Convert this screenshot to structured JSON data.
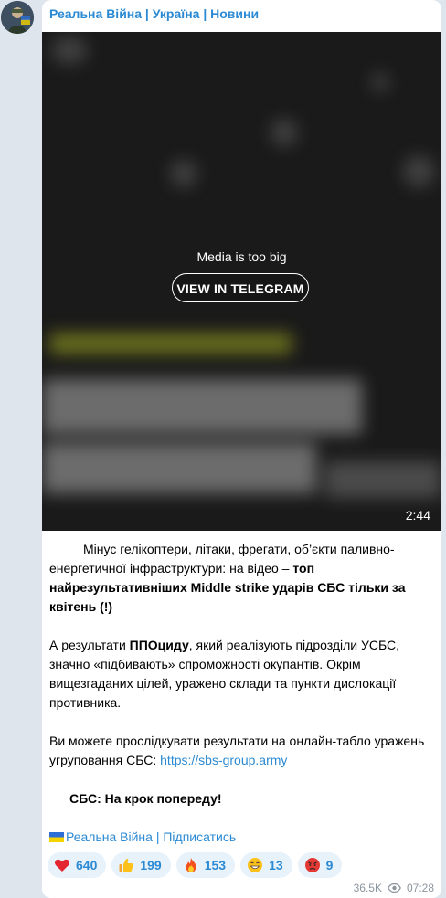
{
  "channel": {
    "name": "Реальна Війна | Україна | Новини"
  },
  "media": {
    "message": "Media is too big",
    "button_label": "VIEW IN TELEGRAM",
    "duration": "2:44"
  },
  "post": {
    "p1_plain": "Мінус гелікоптери, літаки, фрегати, об’єкти паливно-енергетичної інфраструктури: на відео – ",
    "p1_bold": "топ найрезультативніших Middle strike ударів СБС тільки за квітень (!)",
    "p2_a": "А результати ",
    "p2_bold": "ППОциду",
    "p2_b": ", який реалізують підрозділи УСБС, значно «підбивають» спроможності окупантів. Окрім вищезгаданих цілей, уражено склади та пункти дислокації противника.",
    "p3_text": "Ви можете прослідкувати результати на онлайн-табло уражень угруповання СБС: ",
    "p3_link": "https://sbs-group.army",
    "slogan": "СБС: На крок попереду!",
    "subscribe_link": "Реальна Війна | Підписатись"
  },
  "reactions": [
    {
      "icon": "heart-icon",
      "count": "640"
    },
    {
      "icon": "thumbs-up-icon",
      "count": "199"
    },
    {
      "icon": "fire-icon",
      "count": "153"
    },
    {
      "icon": "grin-icon",
      "count": "13"
    },
    {
      "icon": "angry-face-icon",
      "count": "9"
    }
  ],
  "meta": {
    "views": "36.5K",
    "time": "07:28"
  }
}
